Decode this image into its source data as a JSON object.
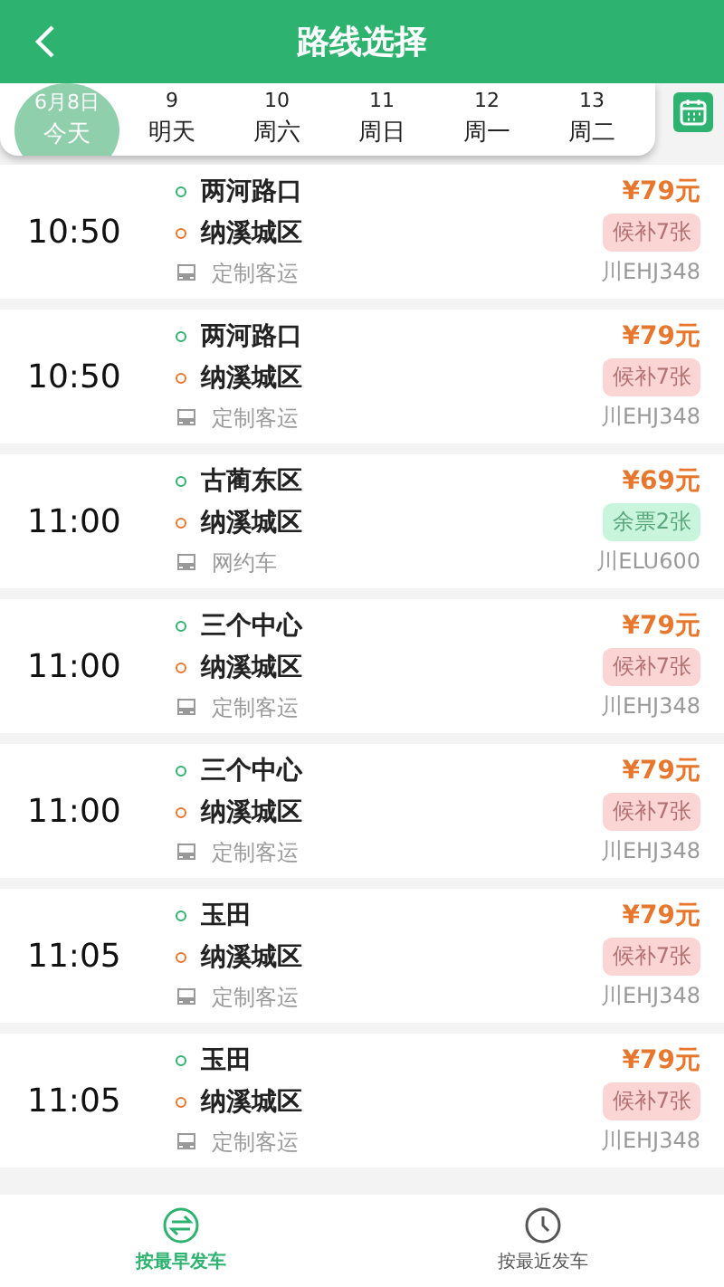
{
  "header": {
    "title": "路线选择"
  },
  "dates": [
    {
      "date": "6月8日",
      "label": "今天",
      "selected": true
    },
    {
      "date": "9",
      "label": "明天",
      "selected": false
    },
    {
      "date": "10",
      "label": "周六",
      "selected": false
    },
    {
      "date": "11",
      "label": "周日",
      "selected": false
    },
    {
      "date": "12",
      "label": "周一",
      "selected": false
    },
    {
      "date": "13",
      "label": "周二",
      "selected": false
    }
  ],
  "trips": [
    {
      "time": "10:50",
      "from": "两河路口",
      "to": "纳溪城区",
      "service": "定制客运",
      "price": "¥79元",
      "tickets": {
        "kind": "waitlist",
        "text": "候补7张"
      },
      "plate": "川EHJ348"
    },
    {
      "time": "10:50",
      "from": "两河路口",
      "to": "纳溪城区",
      "service": "定制客运",
      "price": "¥79元",
      "tickets": {
        "kind": "waitlist",
        "text": "候补7张"
      },
      "plate": "川EHJ348"
    },
    {
      "time": "11:00",
      "from": "古蔺东区",
      "to": "纳溪城区",
      "service": "网约车",
      "price": "¥69元",
      "tickets": {
        "kind": "available",
        "text": "余票2张"
      },
      "plate": "川ELU600"
    },
    {
      "time": "11:00",
      "from": "三个中心",
      "to": "纳溪城区",
      "service": "定制客运",
      "price": "¥79元",
      "tickets": {
        "kind": "waitlist",
        "text": "候补7张"
      },
      "plate": "川EHJ348"
    },
    {
      "time": "11:00",
      "from": "三个中心",
      "to": "纳溪城区",
      "service": "定制客运",
      "price": "¥79元",
      "tickets": {
        "kind": "waitlist",
        "text": "候补7张"
      },
      "plate": "川EHJ348"
    },
    {
      "time": "11:05",
      "from": "玉田",
      "to": "纳溪城区",
      "service": "定制客运",
      "price": "¥79元",
      "tickets": {
        "kind": "waitlist",
        "text": "候补7张"
      },
      "plate": "川EHJ348"
    },
    {
      "time": "11:05",
      "from": "玉田",
      "to": "纳溪城区",
      "service": "定制客运",
      "price": "¥79元",
      "tickets": {
        "kind": "waitlist",
        "text": "候补7张"
      },
      "plate": "川EHJ348"
    }
  ],
  "bottom_nav": [
    {
      "kind": "earliest",
      "label": "按最早发车",
      "selected": true
    },
    {
      "kind": "latest",
      "label": "按最近发车",
      "selected": false
    }
  ]
}
